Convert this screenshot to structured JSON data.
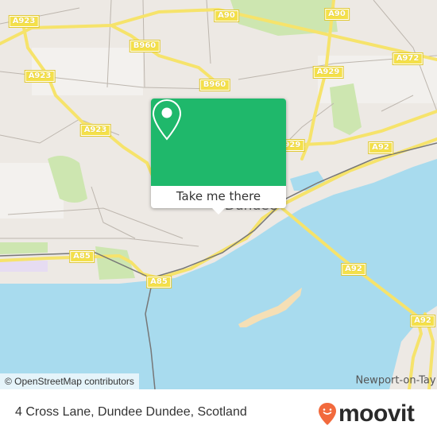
{
  "map": {
    "colors": {
      "land": "#ede9e4",
      "water": "#a8dbee",
      "road": "#f6e36b",
      "park": "#cde6b0",
      "sand": "#f5dfb5",
      "rail": "#777777",
      "popup_green": "#1fb86b",
      "moovit_orange": "#f26a3d"
    },
    "road_labels": [
      {
        "id": "a923-1",
        "text": "A923"
      },
      {
        "id": "b960-1",
        "text": "B960"
      },
      {
        "id": "a923-2",
        "text": "A923"
      },
      {
        "id": "b960-2",
        "text": "B960"
      },
      {
        "id": "a923-3",
        "text": "A923"
      },
      {
        "id": "a90-1",
        "text": "A90"
      },
      {
        "id": "a90-2",
        "text": "A90"
      },
      {
        "id": "a972",
        "text": "A972"
      },
      {
        "id": "a929-1",
        "text": "A929"
      },
      {
        "id": "a929-2",
        "text": "A929"
      },
      {
        "id": "a92-1",
        "text": "A92"
      },
      {
        "id": "a85-1",
        "text": "A85"
      },
      {
        "id": "a85-2",
        "text": "A85"
      },
      {
        "id": "a92-2",
        "text": "A92"
      },
      {
        "id": "a92-3",
        "text": "A92"
      }
    ],
    "places": {
      "dundee": "Dundee",
      "newport": "Newport-on-Tay"
    },
    "attribution": "© OpenStreetMap contributors"
  },
  "popup": {
    "icon": "location-pin-icon",
    "button_label": "Take me there"
  },
  "footer": {
    "address": "4 Cross Lane, Dundee Dundee, Scotland",
    "brand": "moovit",
    "brand_icon": "moovit-smiley-pin-icon"
  }
}
